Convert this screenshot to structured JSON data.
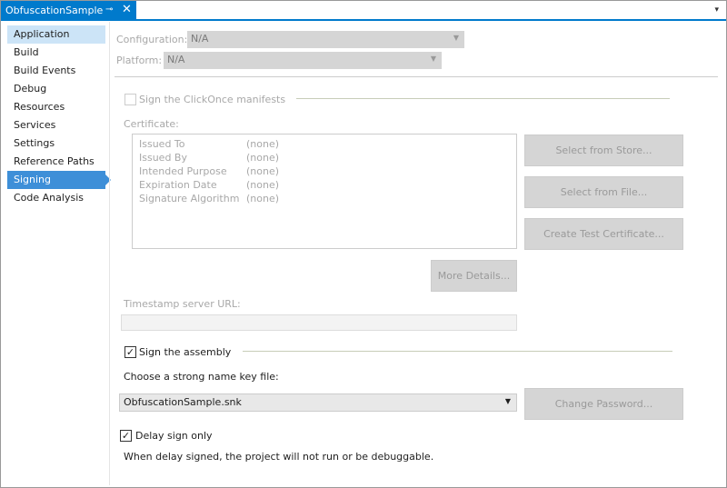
{
  "tab": {
    "title": "ObfuscationSample",
    "pin": "⊸",
    "close": "✕",
    "overflow": "▾"
  },
  "sidebar": {
    "items": [
      {
        "label": "Application"
      },
      {
        "label": "Build"
      },
      {
        "label": "Build Events"
      },
      {
        "label": "Debug"
      },
      {
        "label": "Resources"
      },
      {
        "label": "Services"
      },
      {
        "label": "Settings"
      },
      {
        "label": "Reference Paths"
      },
      {
        "label": "Signing"
      },
      {
        "label": "Code Analysis"
      }
    ]
  },
  "config": {
    "configuration_label": "Configuration:",
    "configuration_value": "N/A",
    "platform_label": "Platform:",
    "platform_value": "N/A"
  },
  "signing": {
    "clickonce_label": "Sign the ClickOnce manifests",
    "certificate_label": "Certificate:",
    "certificate_rows": [
      {
        "k": "Issued To",
        "v": "(none)"
      },
      {
        "k": "Issued By",
        "v": "(none)"
      },
      {
        "k": "Intended Purpose",
        "v": "(none)"
      },
      {
        "k": "Expiration Date",
        "v": "(none)"
      },
      {
        "k": "Signature Algorithm",
        "v": "(none)"
      }
    ],
    "select_store": "Select from Store...",
    "select_file": "Select from File...",
    "create_test": "Create Test Certificate...",
    "more_details": "More Details...",
    "timestamp_label": "Timestamp server URL:",
    "timestamp_value": "",
    "sign_assembly_label": "Sign the assembly",
    "sign_assembly_checked": true,
    "key_file_label": "Choose a strong name key file:",
    "key_file_value": "ObfuscationSample.snk",
    "change_password": "Change Password...",
    "delay_sign_label": "Delay sign only",
    "delay_sign_checked": true,
    "delay_note": "When delay signed, the project will not run or be debuggable."
  }
}
